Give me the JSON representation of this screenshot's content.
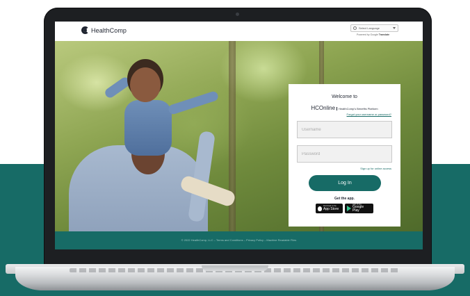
{
  "header": {
    "logo_text": "HealthComp",
    "language_select": "Select Language",
    "powered_by": "Powered by",
    "powered_google": "Google",
    "powered_translate": "Translate"
  },
  "login": {
    "welcome": "Welcome to",
    "brand": "HCOnline",
    "brand_sub": "HealthComp's Benefits Platform",
    "forgot_link": "Forgot your username or password?",
    "username_placeholder": "Username",
    "password_placeholder": "Password",
    "signup_link": "Sign up for online access",
    "login_button": "Log In",
    "get_app": "Get the app.",
    "app_store_small": "Download on the",
    "app_store_big": "App Store",
    "google_play_small": "GET IT ON",
    "google_play_big": "Google Play"
  },
  "footer": {
    "text": "© 2022 HealthComp, LLC – Terms and Conditions – Privacy Policy – Machine Readable Files"
  },
  "colors": {
    "brand_teal": "#176b66",
    "laptop_bezel": "#1d1f22",
    "text_dark": "#1f2430"
  },
  "icons": [
    "healthcomp-logo-icon",
    "globe-icon",
    "chevron-down-icon",
    "apple-icon",
    "google-play-icon",
    "camera-icon"
  ]
}
